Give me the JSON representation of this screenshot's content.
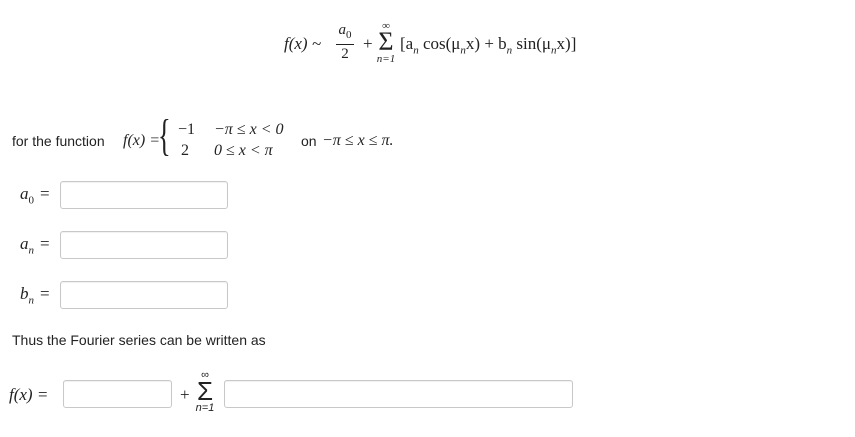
{
  "series_formula": {
    "lhs": "f(x) ~",
    "a0_num": "a",
    "a0_sub": "0",
    "a0_den": "2",
    "plus": "+",
    "sum_upper": "∞",
    "sum_symbol": "Σ",
    "sum_lower": "n=1",
    "term_open": "[a",
    "term_n1": "n",
    "term_cos": " cos(μ",
    "term_n2": "n",
    "term_mid": "x) + b",
    "term_n3": "n",
    "term_sin": " sin(μ",
    "term_n4": "n",
    "term_close": "x)]"
  },
  "function_def": {
    "prefix": "for the function",
    "f_lhs": "f(x) =",
    "case1_value": "−1",
    "case1_domain": "−π ≤ x < 0",
    "case2_value": "2",
    "case2_domain": "0 ≤ x < π",
    "interval_label": "on",
    "interval": "−π ≤ x ≤ π."
  },
  "coefficients": {
    "a0_label": "a",
    "a0_sub": "0",
    "an_label": "a",
    "an_sub": "n",
    "bn_label": "b",
    "bn_sub": "n",
    "equals": "=",
    "a0_value": "",
    "an_value": "",
    "bn_value": ""
  },
  "conclusion_text": "Thus the Fourier series can be written as",
  "final_formula": {
    "lhs": "f(x) =",
    "plus": "+",
    "sum_upper": "∞",
    "sum_symbol": "Σ",
    "sum_lower": "n=1",
    "constant_value": "",
    "series_value": ""
  }
}
